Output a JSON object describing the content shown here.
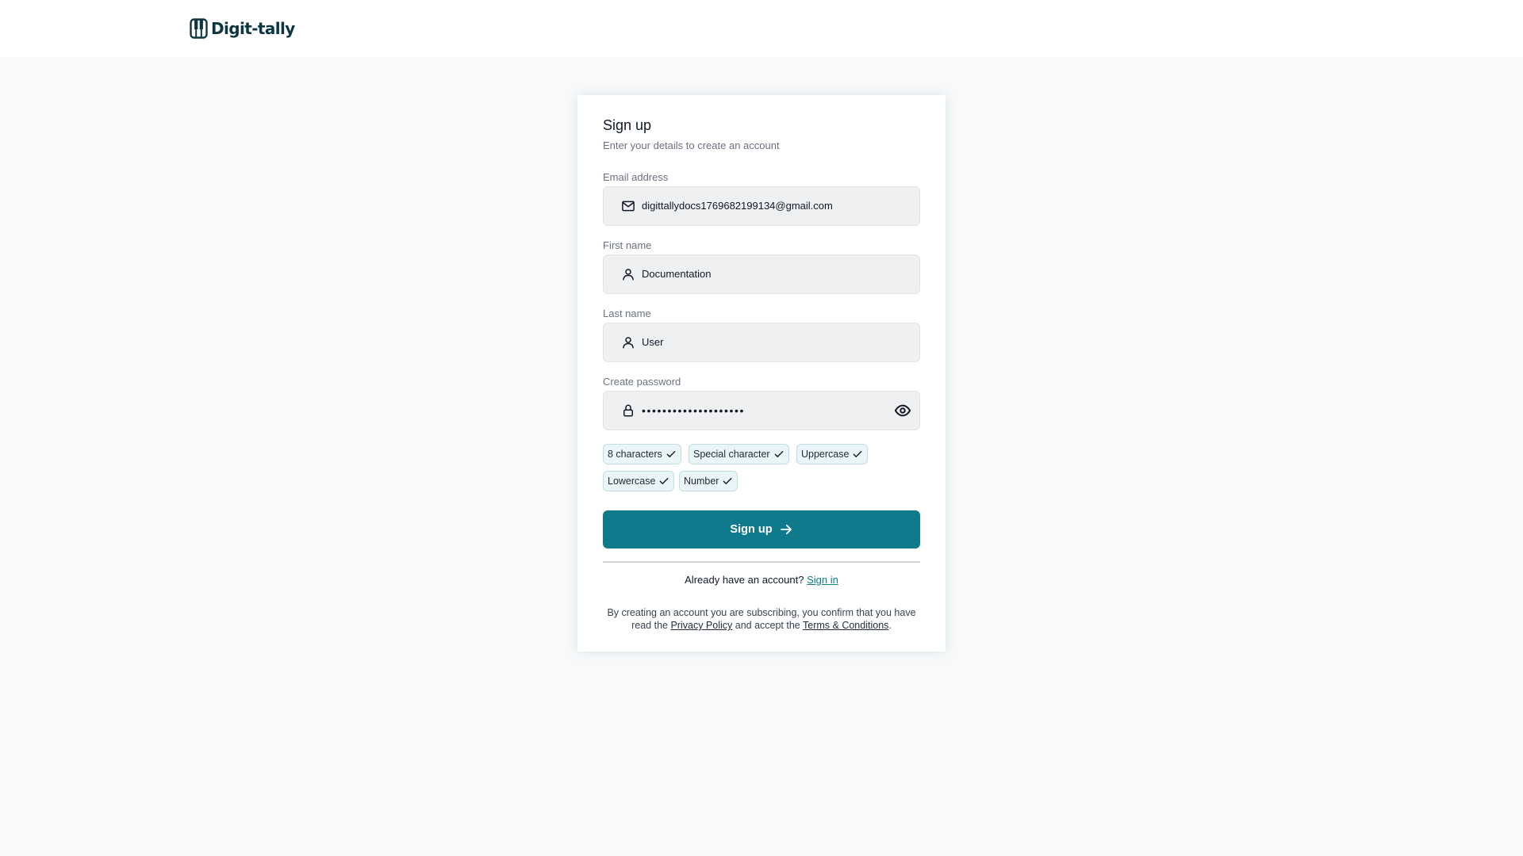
{
  "brand": {
    "name": "Digit-tally",
    "color": "#0e3640",
    "accent": "#0e7a8c"
  },
  "header": {
    "logo_icon": "piano-logo-icon"
  },
  "form": {
    "title": "Sign up",
    "subtitle": "Enter your details to create an account",
    "fields": [
      {
        "label": "Email address",
        "value": "digittallydocs1769682199134@gmail.com",
        "icon": "mail-icon"
      },
      {
        "label": "First name",
        "value": "Documentation",
        "icon": "user-icon"
      },
      {
        "label": "Last name",
        "value": "User",
        "icon": "user-icon"
      },
      {
        "label": "Create password",
        "value": "••••••••••••••••••••",
        "icon": "lock-icon",
        "toggle_icon": "eye-icon"
      }
    ],
    "requirements": [
      {
        "label": "8 characters",
        "met": true
      },
      {
        "label": "Special character",
        "met": true
      },
      {
        "label": "Uppercase",
        "met": true
      },
      {
        "label": "Lowercase",
        "met": true
      },
      {
        "label": "Number",
        "met": true
      }
    ],
    "submit_label": "Sign up",
    "submit_icon": "arrow-right-icon"
  },
  "signin": {
    "prompt": "Already have an account?",
    "link": "Sign in"
  },
  "legal": {
    "pre": "By creating an account you are subscribing, you confirm that you have read the",
    "privacy": "Privacy Policy",
    "mid": "and accept the",
    "terms": "Terms & Conditions",
    "post": "."
  }
}
